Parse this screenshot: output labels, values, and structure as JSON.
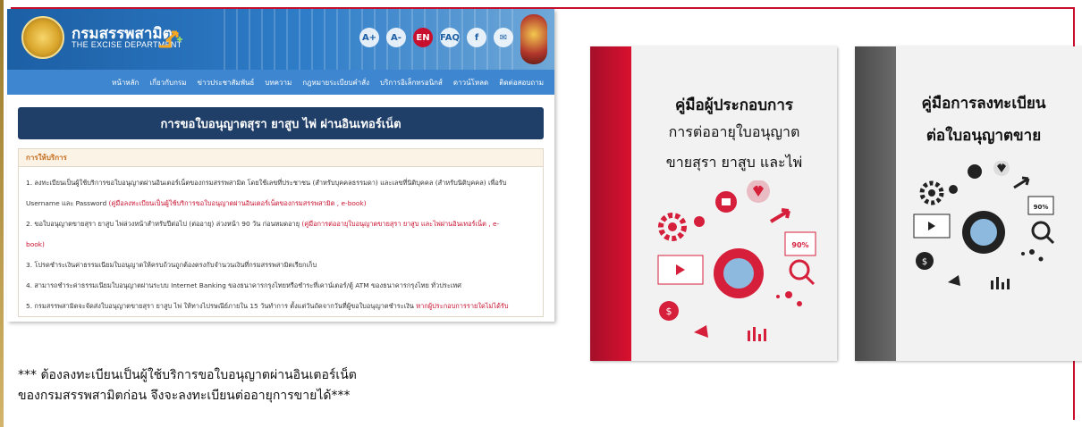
{
  "site": {
    "logo_th": "กรมสรรพสามิต",
    "logo_en": "THE EXCISE DEPARTMENT",
    "header_icons": [
      {
        "label": "A+",
        "name": "font-increase-icon"
      },
      {
        "label": "A-",
        "name": "font-decrease-icon"
      },
      {
        "label": "EN",
        "name": "english-flag-icon"
      },
      {
        "label": "FAQ",
        "name": "faq-icon"
      },
      {
        "label": "f",
        "name": "facebook-icon"
      },
      {
        "label": "✉",
        "name": "email-icon"
      },
      {
        "label": "⚲",
        "name": "search-icon"
      }
    ],
    "nav": [
      "หน้าหลัก",
      "เกี่ยวกับกรม",
      "ข่าวประชาสัมพันธ์",
      "บทความ",
      "กฎหมายระเบียบคำสั่ง",
      "บริการอิเล็กทรอนิกส์",
      "ดาวน์โหลด",
      "ติดต่อสอบถาม"
    ],
    "page_title": "การขอใบอนุญาตสุรา ยาสูบ ไพ่ ผ่านอินเทอร์เน็ต",
    "section_head": "การให้บริการ",
    "items": [
      {
        "text": "1. ลงทะเบียนเป็นผู้ใช้บริการขอใบอนุญาตผ่านอินเตอร์เน็ตของกรมสรรพสามิต โดยใช้เลขที่ประชาชน (สำหรับบุคคลธรรมดา) และเลขที่นิติบุคคล (สำหรับนิติบุคคล) เพื่อรับ",
        "link": ""
      },
      {
        "text": "Username และ Password ",
        "link": "(คู่มือลงทะเบียนเป็นผู้ใช้บริการขอใบอนุญาตผ่านอินเตอร์เน็ตของกรมสรรพสามิต , e-book)"
      },
      {
        "text": "2. ขอใบอนุญาตขายสุรา ยาสูบ ไพ่ล่วงหน้าสำหรับปีต่อไป (ต่ออายุ) ล่วงหน้า 90 วัน ก่อนหมดอายุ ",
        "link": "(คู่มือการต่ออายุใบอนุญาตขายสุรา ยาสูบ และไพ่ผ่านอินเทอร์เน็ต , e-"
      },
      {
        "text": "",
        "link": "book)"
      },
      {
        "text": "3. โปรดชำระเงินค่าธรรมเนียมใบอนุญาตให้ครบถ้วนถูกต้องตรงกับจำนวนเงินที่กรมสรรพสามิตเรียกเก็บ",
        "link": ""
      },
      {
        "text": "4. สามารถชำระค่าธรรมเนียมใบอนุญาตผ่านระบบ Internet Banking ของธนาคารกรุงไทยหรือชำระที่เคาน์เตอร์/ตู้ ATM ของธนาคารกรุงไทย ทั่วประเทศ",
        "link": ""
      },
      {
        "text": "5. กรมสรรพสามิตจะจัดส่งใบอนุญาตขายสุรา ยาสูบ ไพ่ ให้ทางไปรษณีย์ภายใน 15 วันทำการ ตั้งแต่วันถัดจากวันที่ผู้ขอใบอนุญาตชำระเงิน ",
        "link": "หากผู้ประกอบการรายใดไม่ได้รับ"
      }
    ]
  },
  "note": {
    "line1": "*** ต้องลงทะเบียนเป็นผู้ใช้บริการขอใบอนุญาตผ่านอินเตอร์เน็ต",
    "line2": "ของกรมสรรพสามิตก่อน จึงจะลงทะเบียนต่ออายุการขายได้***"
  },
  "books": [
    {
      "line1": "คู่มือผู้ประกอบการ",
      "line2": "การต่ออายุใบอนุญาต",
      "line3": "ขายสุรา ยาสูบ และไพ่",
      "spine_color": "#c8102e",
      "badge": "90%"
    },
    {
      "line1": "คู่มือการลงทะเบียน",
      "line2": "ต่อใบอนุญาตขาย",
      "spine_color": "#555555",
      "badge": "90%"
    }
  ]
}
